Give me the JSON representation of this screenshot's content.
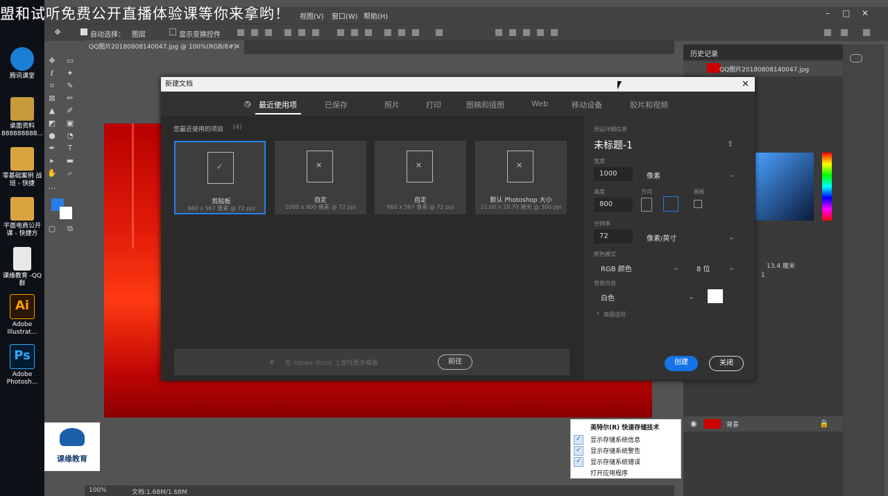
{
  "banner": "盟和试听免费公开直播体验课等你来拿哟！",
  "desktop_icons": [
    {
      "label": "腾讯课堂",
      "color": "#1a7fd4"
    },
    {
      "label": "桌面资料 888888888...",
      "color": "#c89a3c"
    },
    {
      "label": "零基础案例 战班 - 快捷",
      "color": "#d9a440"
    },
    {
      "label": "平面电商公开 课 - 快捷方",
      "color": "#d9a440"
    },
    {
      "label": "课缘教育 -QQ群",
      "color": "#e8e8e8"
    },
    {
      "label": "Adobe Illustrat...",
      "color": "#2b1700",
      "badge": "Ai",
      "badge_color": "#ff9a00"
    },
    {
      "label": "Adobe Photosh...",
      "color": "#001d34",
      "badge": "Ps",
      "badge_color": "#31a8ff"
    }
  ],
  "logo": {
    "text": "课缘教育"
  },
  "menubar": {
    "items": [
      "视图(V)",
      "窗口(W)",
      "帮助(H)"
    ]
  },
  "options_bar": {
    "auto_select": "自动选择：",
    "layer_select": "图层",
    "show_transform": "显示变换控件"
  },
  "doc_tab": "QQ图片20180808140047.jpg @ 100%(RGB/8#)",
  "status": {
    "zoom": "100%",
    "doc_info": "文档:1.68M/1.68M"
  },
  "history_panel": {
    "title": "历史记录",
    "item": "QQ图片20180808140047.jpg"
  },
  "info_panel": {
    "values": "13.4 厘米",
    "secondary": "1"
  },
  "layers_panel": {
    "layer_name": "背景"
  },
  "dialog": {
    "title": "新建文档",
    "tabs": [
      "最近使用项",
      "已保存",
      "照片",
      "打印",
      "图稿和插图",
      "Web",
      "移动设备",
      "胶片和视频"
    ],
    "recent_label": "您最近使用的项目",
    "recent_count": "(4)",
    "cards": [
      {
        "name": "剪贴板",
        "sub": "660 x 567 像素 @ 72 ppi",
        "selected": true
      },
      {
        "name": "自定",
        "sub": "1000 x 800 像素 @ 72 ppi",
        "selected": false
      },
      {
        "name": "自定",
        "sub": "660 x 567 像素 @ 72 ppi",
        "selected": false
      },
      {
        "name": "默认 Photoshop 大小",
        "sub": "21.00 x 29.70 厘米 @ 300 ppi",
        "selected": false
      }
    ],
    "search_placeholder": "在 Adobe Stock 上查找更多模板",
    "search_button": "前往",
    "details_label": "预设详细信息",
    "doc_name": "未标题-1",
    "width_label": "宽度",
    "width_value": "1000",
    "width_unit": "像素",
    "height_label": "高度",
    "height_value": "800",
    "orientation_label": "方向",
    "artboard_label": "画板",
    "resolution_label": "分辨率",
    "resolution_value": "72",
    "resolution_unit": "像素/英寸",
    "color_mode_label": "颜色模式",
    "color_mode_value": "RGB 颜色",
    "bit_depth": "8 位",
    "bg_label": "背景内容",
    "bg_value": "白色",
    "advanced": "高级选项",
    "create_button": "创建",
    "close_button": "关闭"
  },
  "context_menu": {
    "title": "英特尔(R) 快速存储技术",
    "items": [
      {
        "label": "显示存储系统信息",
        "checked": true
      },
      {
        "label": "显示存储系统警告",
        "checked": true
      },
      {
        "label": "显示存储系统错误",
        "checked": true
      },
      {
        "label": "打开应用程序",
        "checked": false
      }
    ]
  }
}
